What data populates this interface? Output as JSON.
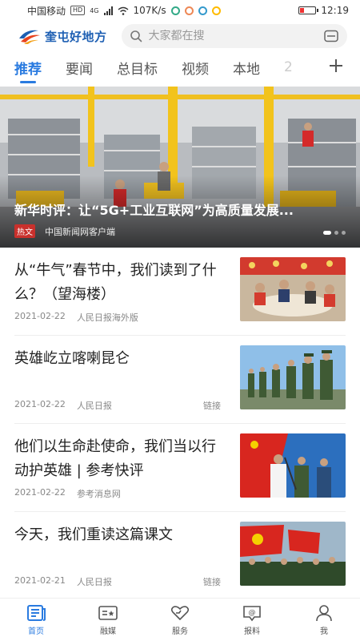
{
  "status_bar": {
    "carrier": "中国移动",
    "carrier_badge": "HD",
    "network": "4G",
    "speed": "107K/s",
    "time": "12:19"
  },
  "header": {
    "logo_text": "奎屯好地方",
    "search_placeholder": "大家都在搜"
  },
  "tabs": [
    {
      "label": "推荐",
      "active": true
    },
    {
      "label": "要闻",
      "active": false
    },
    {
      "label": "总目标",
      "active": false
    },
    {
      "label": "视频",
      "active": false
    },
    {
      "label": "本地",
      "active": false
    },
    {
      "label": "2",
      "active": false
    }
  ],
  "hero": {
    "title": "新华时评：让“5G+工业互联网”为高质量发展...",
    "tag": "热文",
    "source": "中国新闻网客户端"
  },
  "news": [
    {
      "title": "从“牛气”春节中，我们读到了什么？（望海楼）",
      "date": "2021-02-22",
      "source": "人民日报海外版",
      "link": ""
    },
    {
      "title": "英雄屹立喀喇昆仑",
      "date": "2021-02-22",
      "source": "人民日报",
      "link": "链接"
    },
    {
      "title": "他们以生命赴使命，我们当以行动护英雄 | 参考快评",
      "date": "2021-02-22",
      "source": "参考消息网",
      "link": ""
    },
    {
      "title": "今天，我们重读这篇课文",
      "date": "2021-02-21",
      "source": "人民日报",
      "link": "链接"
    }
  ],
  "bottom_nav": [
    {
      "label": "首页",
      "icon": "home-news-icon",
      "active": true
    },
    {
      "label": "融媒",
      "icon": "media-icon",
      "active": false
    },
    {
      "label": "服务",
      "icon": "heart-service-icon",
      "active": false
    },
    {
      "label": "报料",
      "icon": "report-icon",
      "active": false
    },
    {
      "label": "我",
      "icon": "user-icon",
      "active": false
    }
  ],
  "colors": {
    "accent": "#2a7be0",
    "tag_red": "#c9302c"
  }
}
